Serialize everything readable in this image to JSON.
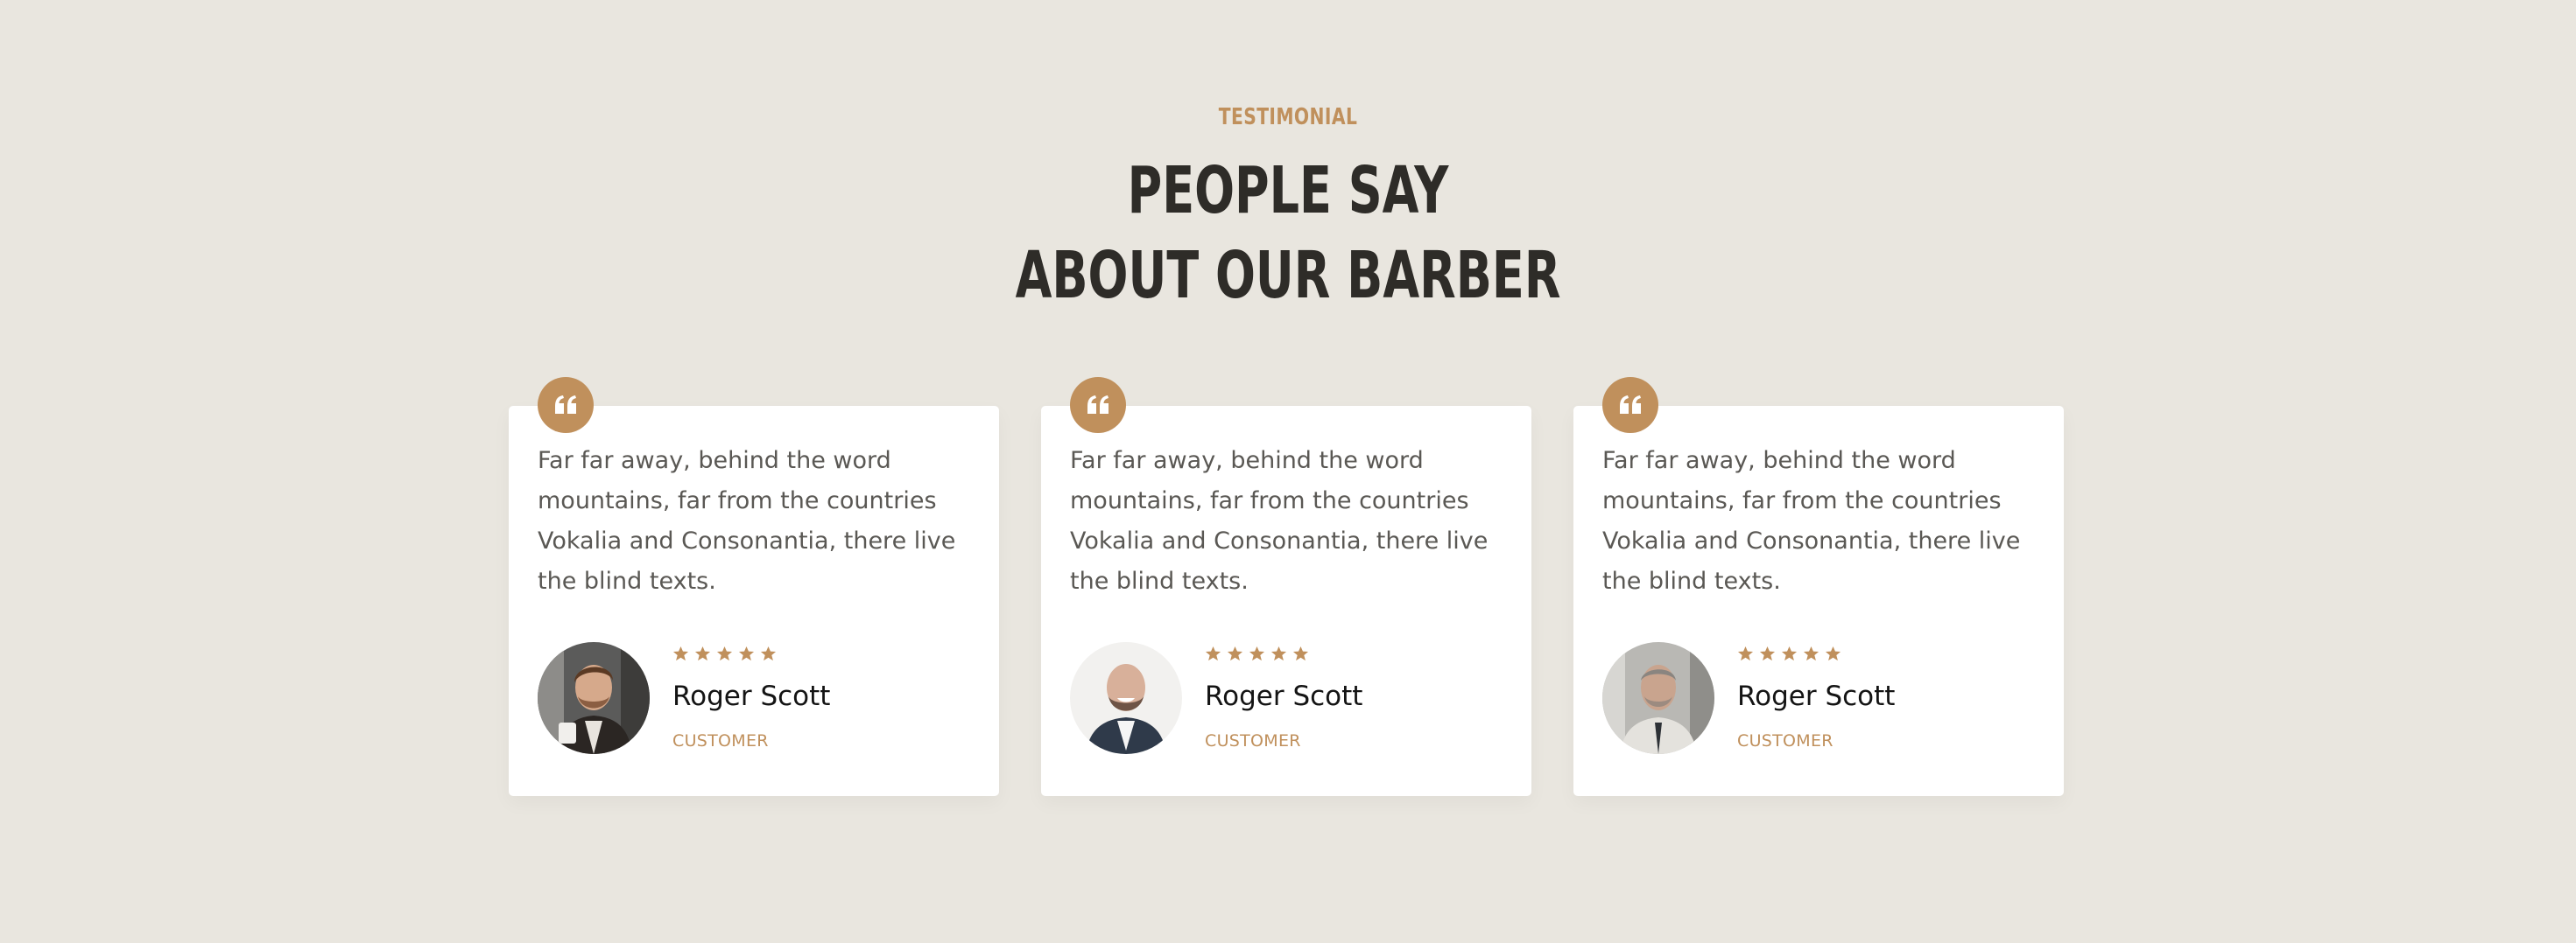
{
  "section": {
    "subheading": "TESTIMONIAL",
    "title_line1": "PEOPLE SAY",
    "title_line2": "ABOUT OUR BARBER"
  },
  "colors": {
    "background": "#e9e6df",
    "accent": "#c0905c",
    "heading": "#2e2c28",
    "card": "#ffffff"
  },
  "testimonials": [
    {
      "text": "Far far away, behind the word mountains, far from the countries Vokalia and Consonantia, there live the blind texts.",
      "rating": 5,
      "name": "Roger Scott",
      "role": "CUSTOMER",
      "quote_icon": "quote-icon",
      "avatar_icon": "avatar-photo"
    },
    {
      "text": "Far far away, behind the word mountains, far from the countries Vokalia and Consonantia, there live the blind texts.",
      "rating": 5,
      "name": "Roger Scott",
      "role": "CUSTOMER",
      "quote_icon": "quote-icon",
      "avatar_icon": "avatar-photo"
    },
    {
      "text": "Far far away, behind the word mountains, far from the countries Vokalia and Consonantia, there live the blind texts.",
      "rating": 5,
      "name": "Roger Scott",
      "role": "CUSTOMER",
      "quote_icon": "quote-icon",
      "avatar_icon": "avatar-photo"
    }
  ]
}
